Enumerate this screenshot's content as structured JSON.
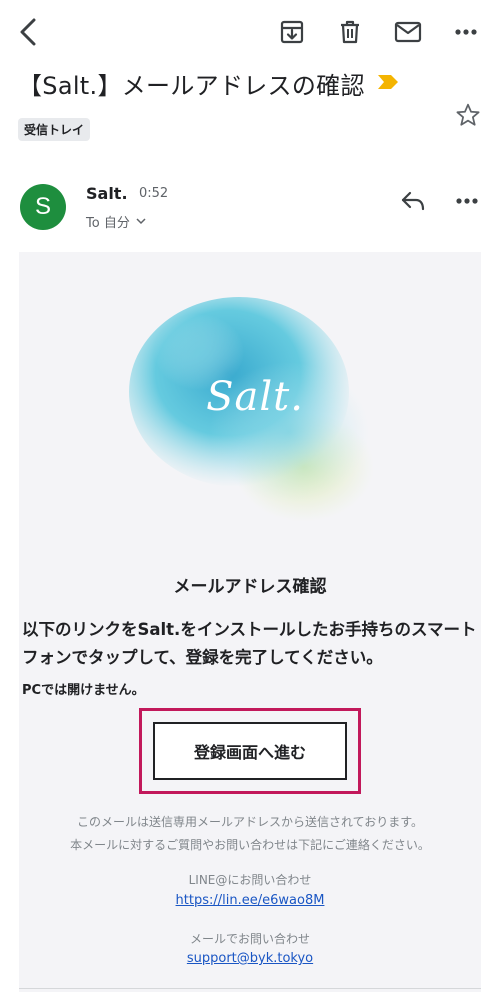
{
  "toolbar": {
    "back_icon": "back-arrow-icon",
    "archive_icon": "archive-icon",
    "delete_icon": "trash-icon",
    "mark_unread_icon": "mail-icon",
    "more_icon": "more-horizontal-icon"
  },
  "message": {
    "subject": "【Salt.】メールアドレスの確認",
    "label": "受信トレイ",
    "importance_color": "#f4b400",
    "sender_initial": "S",
    "sender_name": "Salt.",
    "time": "0:52",
    "to_line": "To 自分",
    "avatar_color": "#1e8e3e"
  },
  "body": {
    "logo_text": "Salt.",
    "heading": "メールアドレス確認",
    "description": "以下のリンクをSalt.をインストールしたお手持ちのスマートフォンでタップして、登録を完了してください。",
    "note": "PCでは開けません。",
    "cta_label": "登録画面へ進む",
    "highlight_color": "#c2185b",
    "footer_line1": "このメールは送信専用メールアドレスから送信されております。",
    "footer_line2": "本メールに対するご質問やお問い合わせは下記にご連絡ください。",
    "line_label": "LINE@にお問い合わせ",
    "line_link": "https://lin.ee/e6wao8M",
    "mail_label": "メールでお問い合わせ",
    "mail_link": "support@byk.tokyo"
  }
}
